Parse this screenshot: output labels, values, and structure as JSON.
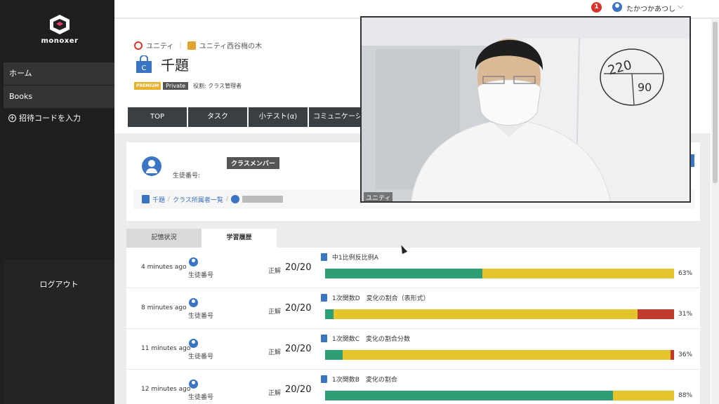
{
  "app": {
    "logo_text": "monoxer"
  },
  "topbar": {
    "notification_count": "1",
    "user_name": "たかつかあつし",
    "chevron": "⌵"
  },
  "sidebar": {
    "items": [
      {
        "label": "ホーム"
      },
      {
        "label": "Books"
      }
    ],
    "invite_label": "招待コードを入力",
    "logout_label": "ログアウト"
  },
  "header": {
    "org_name": "ユニティ",
    "school_name": "ユニティ西谷梅の木",
    "class_icon_letter": "C",
    "class_title": "千題",
    "badge_premium": "PREMIUM",
    "badge_private": "Private",
    "role_text": "役割: クラス管理者"
  },
  "tabs": [
    {
      "label": "TOP"
    },
    {
      "label": "タスク"
    },
    {
      "label": "小テスト(α)"
    },
    {
      "label": "コミュニケーシ"
    }
  ],
  "member": {
    "badge": "クラスメンバー",
    "student_no_label": "生徒番号:",
    "breadcrumb": [
      "千題",
      "/",
      "クラス所属者一覧",
      "/"
    ]
  },
  "subtabs": [
    {
      "label": "記憶状況"
    },
    {
      "label": "学習履歴"
    }
  ],
  "history": [
    {
      "time": "4 minutes ago",
      "student_label": "生徒番号",
      "correct_label": "正解",
      "score": "20/20",
      "title": "中1比例反比例A",
      "pct_label": "63%",
      "green": 0.45,
      "red": 0.0
    },
    {
      "time": "8 minutes ago",
      "student_label": "生徒番号",
      "correct_label": "正解",
      "score": "20/20",
      "title": "1次関数D　変化の割合（表形式）",
      "pct_label": "31%",
      "green": 0.025,
      "red": 0.105
    },
    {
      "time": "11 minutes ago",
      "student_label": "生徒番号",
      "correct_label": "正解",
      "score": "20/20",
      "title": "1次関数C　変化の割合分数",
      "pct_label": "36%",
      "green": 0.05,
      "red": 0.01
    },
    {
      "time": "12 minutes ago",
      "student_label": "生徒番号",
      "correct_label": "正解",
      "score": "20/20",
      "title": "1次関数B　変化の割合",
      "pct_label": "88%",
      "green": 0.825,
      "red": 0.0
    }
  ],
  "video": {
    "label": "ユニティ",
    "whiteboard_numbers": [
      "220",
      "90"
    ]
  },
  "colors": {
    "sidebar_bg": "#1f1f1f",
    "accent_blue": "#3a75c4",
    "bar_green": "#2e9e74",
    "bar_yellow": "#e3c42c",
    "bar_red": "#c0392b",
    "notif_red": "#d9342b",
    "premium": "#e7b12c"
  },
  "icons": {
    "logo": "monoxer-logo-icon",
    "user": "user-avatar-icon",
    "bag": "class-bag-icon",
    "book": "book-icon",
    "plus": "plus-circle-icon"
  }
}
